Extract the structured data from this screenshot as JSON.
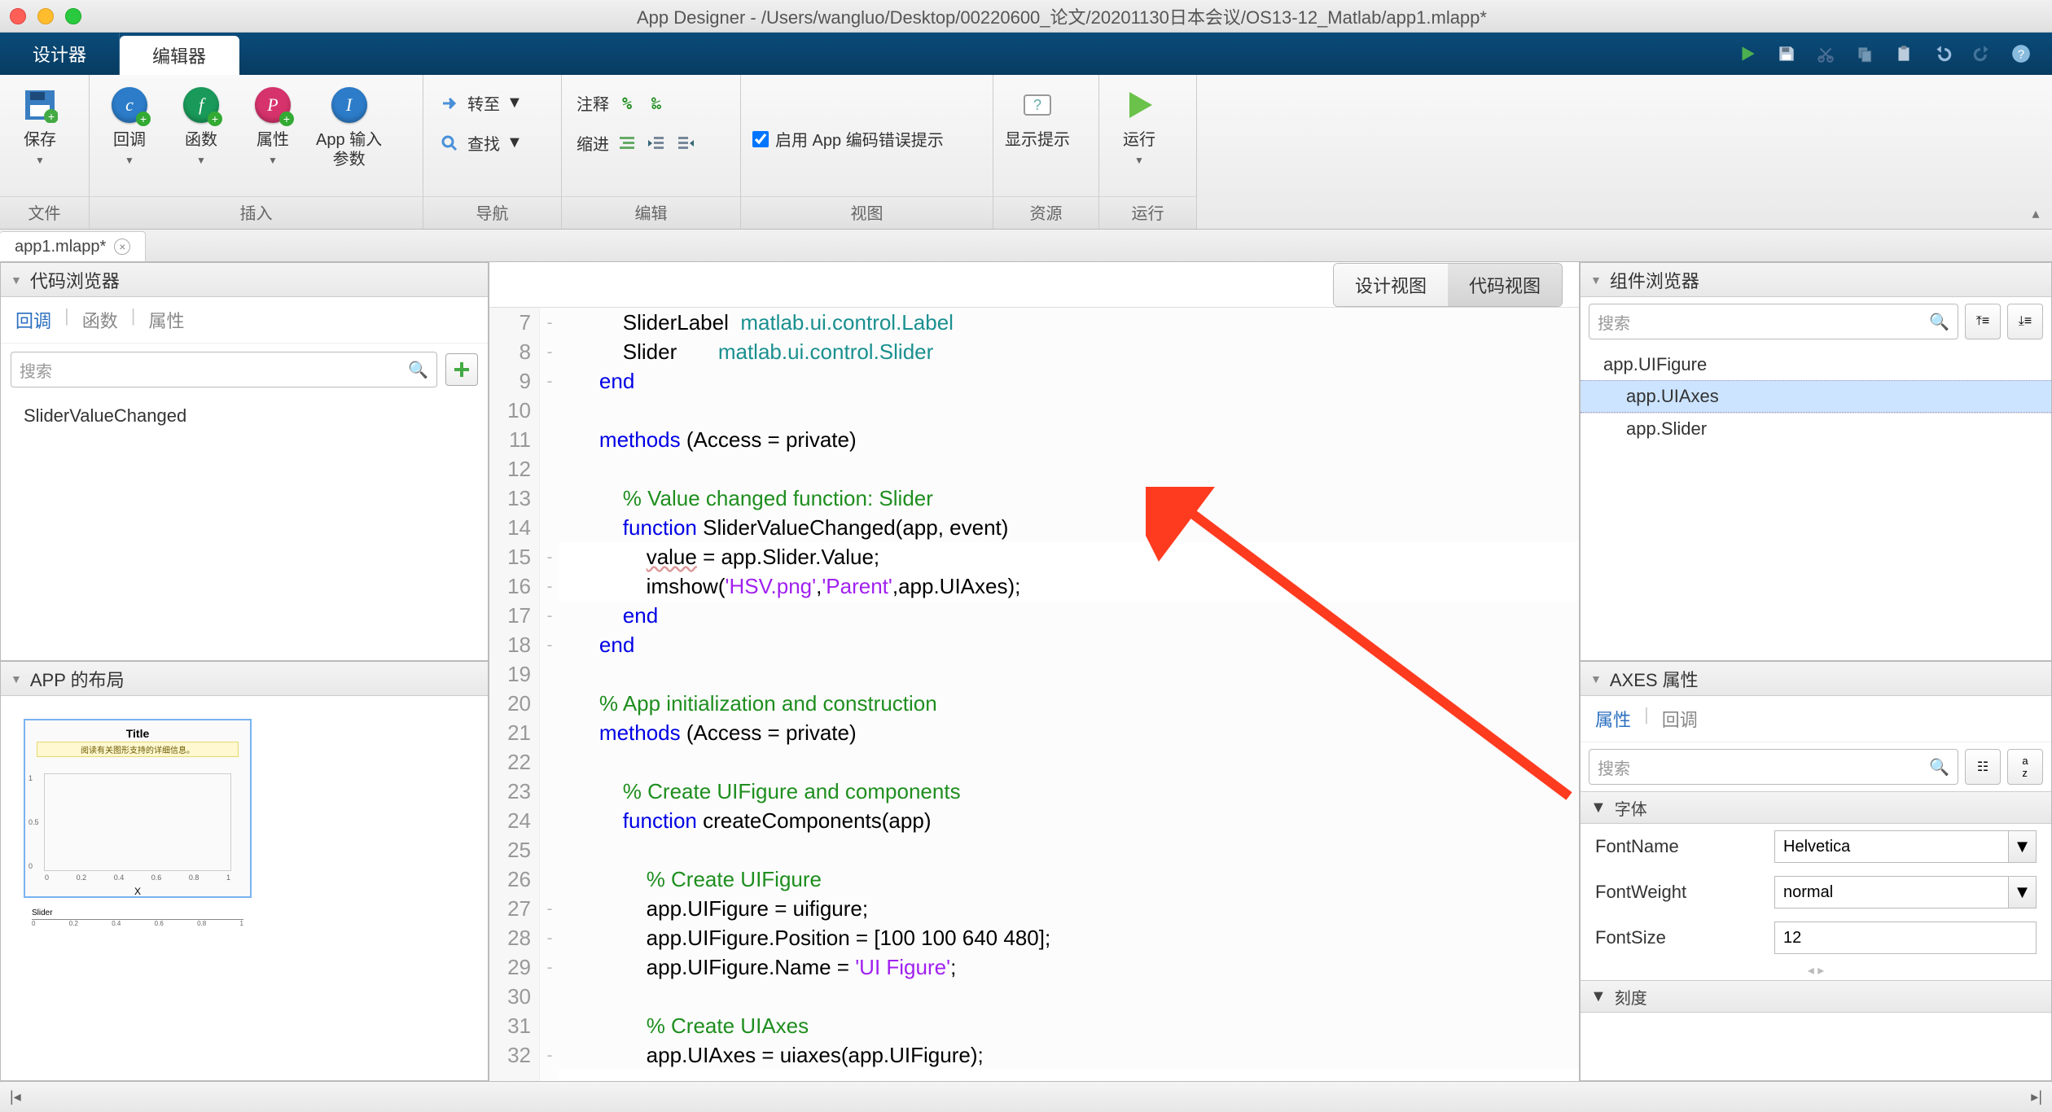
{
  "window": {
    "title": "App Designer - /Users/wangluo/Desktop/00220600_论文/20201130日本会议/OS13-12_Matlab/app1.mlapp*"
  },
  "mainTabs": {
    "designer": "设计器",
    "editor": "编辑器"
  },
  "toolstrip": {
    "groups": {
      "file": "文件",
      "insert": "插入",
      "nav": "导航",
      "edit": "编辑",
      "view": "视图",
      "resource": "资源",
      "run": "运行"
    },
    "save": "保存",
    "callback": "回调",
    "func": "函数",
    "prop": "属性",
    "appInputArgs": "App 输入\n参数",
    "goto": "转至",
    "find": "查找",
    "comment": "注释",
    "indent": "缩进",
    "enableErrors": "启用 App 编码错误提示",
    "showHints": "显示提示",
    "runBtn": "运行"
  },
  "fileTab": {
    "name": "app1.mlapp*"
  },
  "codeBrowser": {
    "title": "代码浏览器",
    "tabs": {
      "callbacks": "回调",
      "funcs": "函数",
      "props": "属性"
    },
    "search": "搜索",
    "item1": "SliderValueChanged"
  },
  "appLayout": {
    "title": "APP 的布局",
    "plotTitle": "Title",
    "note": "阅读有关图形支持的详细信息。",
    "xlabel": "X",
    "sliderLabel": "Slider"
  },
  "viewToggle": {
    "design": "设计视图",
    "code": "代码视图"
  },
  "code": {
    "lines": [
      {
        "n": "7",
        "m": "-",
        "html": "        SliderLabel  <span class='k-teal'>matlab.ui.control.Label</span>"
      },
      {
        "n": "8",
        "m": "-",
        "html": "        Slider       <span class='k-teal'>matlab.ui.control.Slider</span>"
      },
      {
        "n": "9",
        "m": "-",
        "html": "    <span class='k-blue'>end</span>"
      },
      {
        "n": "10",
        "m": "",
        "html": ""
      },
      {
        "n": "11",
        "m": "",
        "html": "    <span class='k-blue'>methods</span> (Access = private)"
      },
      {
        "n": "12",
        "m": "",
        "html": ""
      },
      {
        "n": "13",
        "m": "",
        "html": "        <span class='k-green'>% Value changed function: Slider</span>"
      },
      {
        "n": "14",
        "m": "",
        "html": "        <span class='k-blue'>function</span> SliderValueChanged(app, event)"
      },
      {
        "n": "15",
        "m": "-",
        "html": "            <span style='text-decoration: underline wavy #d99;'>value</span> = app.Slider.Value;",
        "editable": true
      },
      {
        "n": "16",
        "m": "-",
        "html": "            imshow(<span class='k-purple'>'HSV.png'</span>,<span class='k-purple'>'Parent'</span>,app.UIAxes);",
        "editable": true
      },
      {
        "n": "17",
        "m": "-",
        "html": "        <span class='k-blue'>end</span>"
      },
      {
        "n": "18",
        "m": "-",
        "html": "    <span class='k-blue'>end</span>"
      },
      {
        "n": "19",
        "m": "",
        "html": ""
      },
      {
        "n": "20",
        "m": "",
        "html": "    <span class='k-green'>% App initialization and construction</span>"
      },
      {
        "n": "21",
        "m": "",
        "html": "    <span class='k-blue'>methods</span> (Access = private)"
      },
      {
        "n": "22",
        "m": "",
        "html": ""
      },
      {
        "n": "23",
        "m": "",
        "html": "        <span class='k-green'>% Create UIFigure and components</span>"
      },
      {
        "n": "24",
        "m": "",
        "html": "        <span class='k-blue'>function</span> createComponents(app)"
      },
      {
        "n": "25",
        "m": "",
        "html": ""
      },
      {
        "n": "26",
        "m": "",
        "html": "            <span class='k-green'>% Create UIFigure</span>"
      },
      {
        "n": "27",
        "m": "-",
        "html": "            app.UIFigure = uifigure;"
      },
      {
        "n": "28",
        "m": "-",
        "html": "            app.UIFigure.Position = [100 100 640 480];"
      },
      {
        "n": "29",
        "m": "-",
        "html": "            app.UIFigure.Name = <span class='k-purple'>'UI Figure'</span>;"
      },
      {
        "n": "30",
        "m": "",
        "html": ""
      },
      {
        "n": "31",
        "m": "",
        "html": "            <span class='k-green'>% Create UIAxes</span>"
      },
      {
        "n": "32",
        "m": "-",
        "html": "            app.UIAxes = uiaxes(app.UIFigure);"
      }
    ]
  },
  "compBrowser": {
    "title": "组件浏览器",
    "search": "搜索",
    "tree": {
      "root": "app.UIFigure",
      "axes": "app.UIAxes",
      "slider": "app.Slider"
    }
  },
  "axesProps": {
    "title": "AXES 属性",
    "tabs": {
      "props": "属性",
      "callbacks": "回调"
    },
    "search": "搜索",
    "font": "字体",
    "fontName": "FontName",
    "fontNameVal": "Helvetica",
    "fontWeight": "FontWeight",
    "fontWeightVal": "normal",
    "fontSize": "FontSize",
    "fontSizeVal": "12",
    "ticks": "刻度"
  }
}
